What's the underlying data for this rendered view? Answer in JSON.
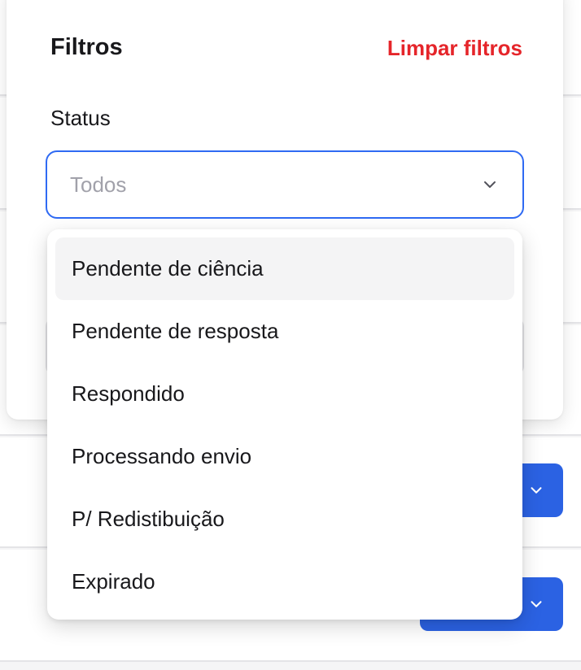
{
  "filters": {
    "title": "Filtros",
    "clear_label": "Limpar filtros",
    "status_label": "Status",
    "select": {
      "placeholder": "Todos",
      "icon": "chevron-down-icon"
    },
    "options": [
      "Pendente de ciência",
      "Pendente de resposta",
      "Respondido",
      "Processando envio",
      "P/ Redistibuição",
      "Expirado"
    ],
    "highlighted_option_index": 0
  },
  "colors": {
    "accent": "#2f6af3",
    "danger": "#e5252a",
    "button_blue": "#2b62e3",
    "text": "#18181b",
    "placeholder": "#a1a1aa"
  }
}
